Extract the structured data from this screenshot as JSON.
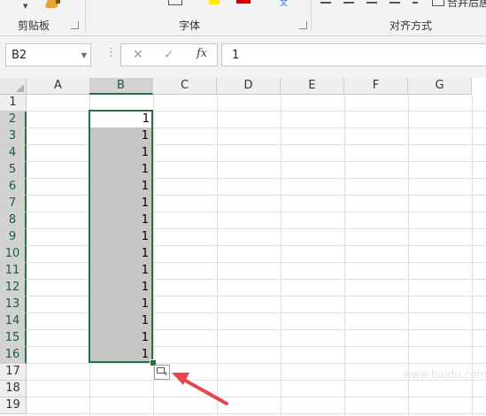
{
  "ribbon": {
    "groups": {
      "clipboard": "剪贴板",
      "font": "字体",
      "alignment": "对齐方式"
    },
    "merge_label": "合并后居"
  },
  "formula_bar": {
    "name_box": "B2",
    "formula_value": "1",
    "cancel_icon": "✕",
    "enter_icon": "✓",
    "fx_label": "fx"
  },
  "sheet": {
    "columns": [
      "A",
      "B",
      "C",
      "D",
      "E",
      "F",
      "G"
    ],
    "selected_column": "B",
    "rows": [
      "1",
      "2",
      "3",
      "4",
      "5",
      "6",
      "7",
      "8",
      "9",
      "10",
      "11",
      "12",
      "13",
      "14",
      "15",
      "16",
      "17",
      "18",
      "19"
    ],
    "selected_rows": [
      "2",
      "3",
      "4",
      "5",
      "6",
      "7",
      "8",
      "9",
      "10",
      "11",
      "12",
      "13",
      "14",
      "15",
      "16"
    ],
    "b_values": [
      "1",
      "1",
      "1",
      "1",
      "1",
      "1",
      "1",
      "1",
      "1",
      "1",
      "1",
      "1",
      "1",
      "1",
      "1"
    ],
    "icons": {
      "select_all": "select-all-triangle-icon",
      "quick_analysis": "auto-fill-options-icon",
      "annotation": "red-arrow-icon"
    }
  },
  "colors": {
    "selection": "#217346",
    "highlight": "#c6c6c6",
    "arrow": "#e8454a"
  },
  "watermark": "www.baidu.com"
}
